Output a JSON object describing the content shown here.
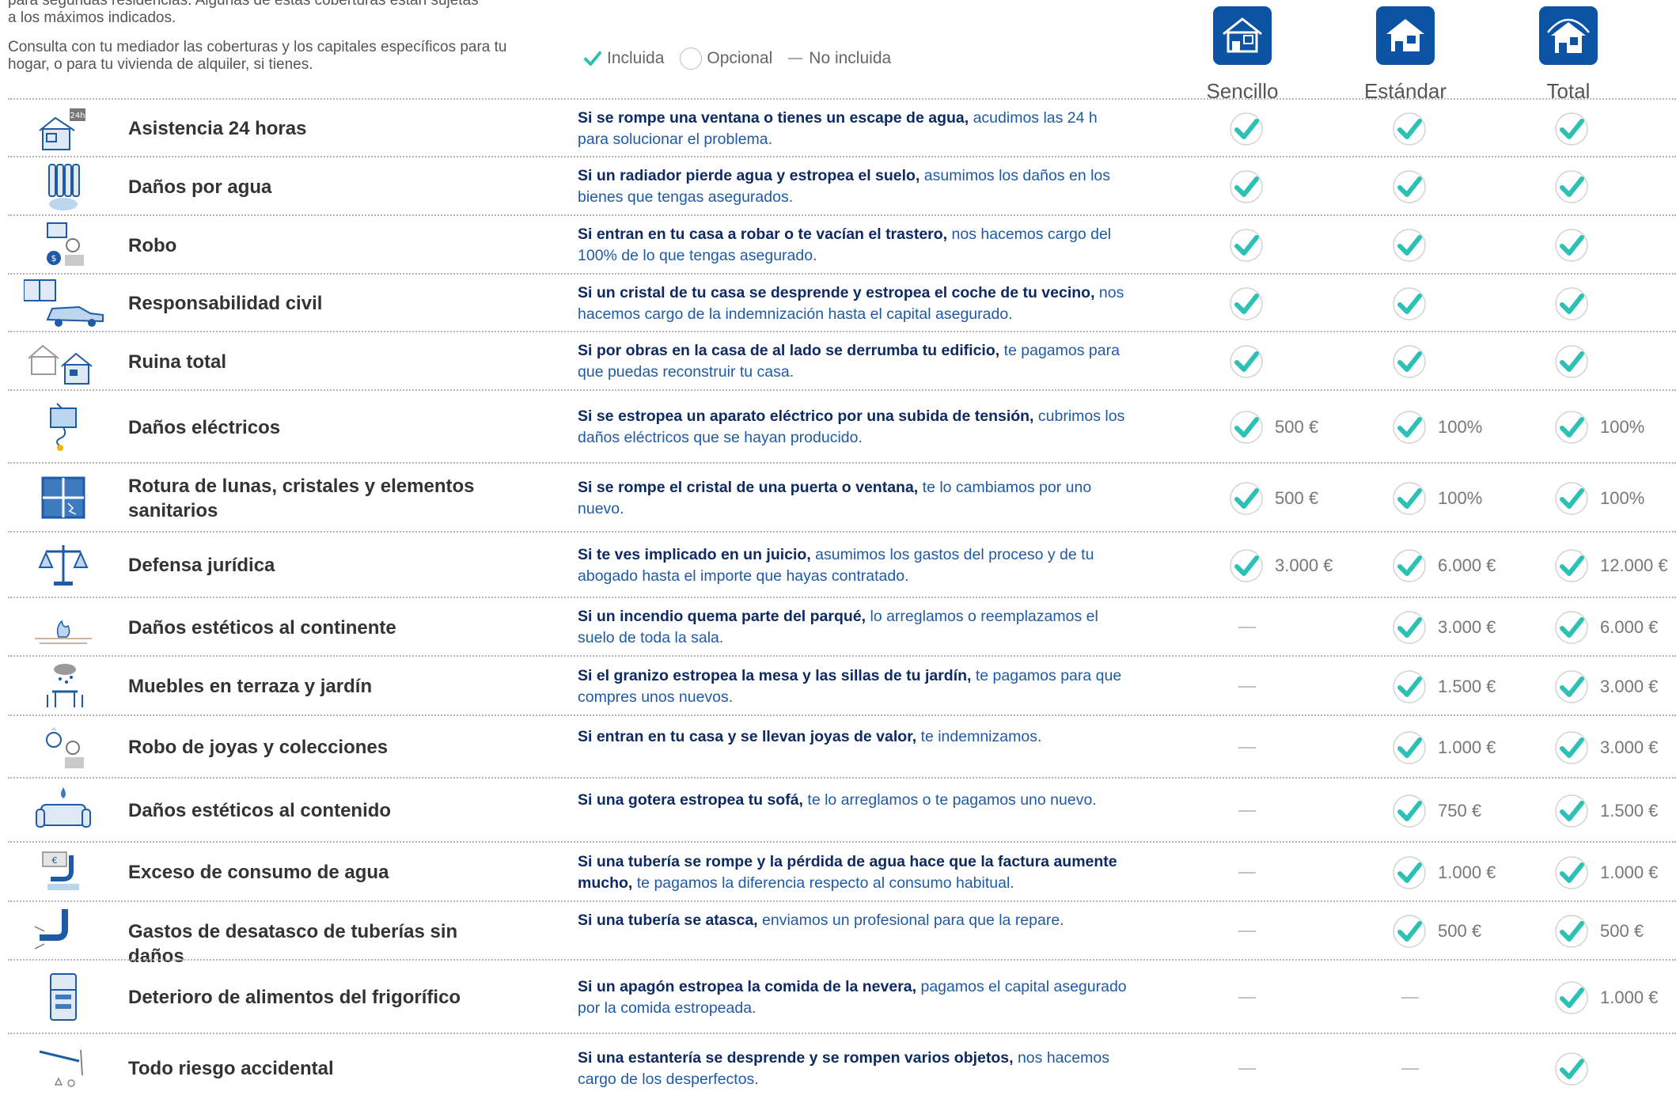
{
  "intro": {
    "line1": "para segundas residencias. Algunas de estas coberturas están sujetas a los máximos indicados.",
    "line2": "Consulta con tu mediador las coberturas y los capitales específicos para tu hogar, o para tu vivienda de alquiler, si tienes."
  },
  "legend": {
    "included": "Incluida",
    "optional": "Opcional",
    "not_included": "No incluida"
  },
  "plans": [
    "Sencillo",
    "Estándar",
    "Total"
  ],
  "colors": {
    "brand_blue": "#0c53a4",
    "check_teal": "#2cc1b4",
    "desc_blue": "#1f5aa6",
    "desc_bold": "#0e2a63"
  },
  "rows": [
    {
      "icon": "house-24h-icon",
      "title": "Asistencia 24 horas",
      "desc_bold": "Si se rompe una ventana o tienes un escape de agua,",
      "desc": " acudimos las 24 h para solucionar el problema.",
      "cells": [
        {
          "status": "included",
          "value": ""
        },
        {
          "status": "included",
          "value": ""
        },
        {
          "status": "included",
          "value": ""
        }
      ]
    },
    {
      "icon": "radiator-icon",
      "title": "Daños por agua",
      "desc_bold": "Si un radiador pierde agua y estropea el suelo,",
      "desc": " asumimos los daños en los bienes que tengas asegurados.",
      "cells": [
        {
          "status": "included",
          "value": ""
        },
        {
          "status": "included",
          "value": ""
        },
        {
          "status": "included",
          "value": ""
        }
      ]
    },
    {
      "icon": "robbery-icon",
      "title": "Robo",
      "desc_bold": "Si entran en tu casa a robar o te vacían el trastero,",
      "desc": " nos hacemos cargo del 100% de lo que tengas asegurado.",
      "cells": [
        {
          "status": "included",
          "value": ""
        },
        {
          "status": "included",
          "value": ""
        },
        {
          "status": "included",
          "value": ""
        }
      ]
    },
    {
      "icon": "window-car-icon",
      "title": "Responsabilidad civil",
      "desc_bold": "Si un cristal de tu casa se desprende y estropea el coche de tu vecino,",
      "desc": " nos hacemos cargo de la indemnización hasta el capital asegurado.",
      "cells": [
        {
          "status": "included",
          "value": ""
        },
        {
          "status": "included",
          "value": ""
        },
        {
          "status": "included",
          "value": ""
        }
      ]
    },
    {
      "icon": "collapsed-house-icon",
      "title": "Ruina total",
      "desc_bold": "Si por obras en la casa de al lado se derrumba tu edificio,",
      "desc": " te pagamos para que puedas reconstruir tu casa.",
      "cells": [
        {
          "status": "included",
          "value": ""
        },
        {
          "status": "included",
          "value": ""
        },
        {
          "status": "included",
          "value": ""
        }
      ]
    },
    {
      "icon": "tv-spark-icon",
      "title": "Daños eléctricos",
      "desc_bold": "Si se estropea un aparato eléctrico por una subida de tensión,",
      "desc": " cubrimos los daños eléctricos que se hayan producido.",
      "cells": [
        {
          "status": "included",
          "value": "500 €"
        },
        {
          "status": "included",
          "value": "100%"
        },
        {
          "status": "included",
          "value": "100%"
        }
      ]
    },
    {
      "icon": "broken-window-icon",
      "title": "Rotura de lunas, cristales y elementos sanitarios",
      "desc_bold": "Si se rompe el cristal de una puerta o ventana,",
      "desc": " te lo cambiamos por uno nuevo.",
      "cells": [
        {
          "status": "included",
          "value": "500 €"
        },
        {
          "status": "included",
          "value": "100%"
        },
        {
          "status": "included",
          "value": "100%"
        }
      ]
    },
    {
      "icon": "scales-icon",
      "title": "Defensa jurídica",
      "desc_bold": "Si te ves implicado en un juicio,",
      "desc": " asumimos los gastos del proceso y de tu abogado hasta el importe que hayas contratado.",
      "cells": [
        {
          "status": "included",
          "value": "3.000 €"
        },
        {
          "status": "included",
          "value": "6.000 €"
        },
        {
          "status": "included",
          "value": "12.000 €"
        }
      ]
    },
    {
      "icon": "burning-floor-icon",
      "title": "Daños estéticos al continente",
      "desc_bold": "Si un incendio quema parte del parqué,",
      "desc": " lo arreglamos o reemplazamos el suelo de toda la sala.",
      "cells": [
        {
          "status": "not_included",
          "value": ""
        },
        {
          "status": "included",
          "value": "3.000 €"
        },
        {
          "status": "included",
          "value": "6.000 €"
        }
      ]
    },
    {
      "icon": "hail-furniture-icon",
      "title": "Muebles en terraza y jardín",
      "desc_bold": "Si el granizo estropea la mesa y las sillas de tu jardín,",
      "desc": " te pagamos para que compres unos nuevos.",
      "cells": [
        {
          "status": "not_included",
          "value": ""
        },
        {
          "status": "included",
          "value": "1.500 €"
        },
        {
          "status": "included",
          "value": "3.000 €"
        }
      ]
    },
    {
      "icon": "jewel-thief-icon",
      "title": "Robo de joyas y colecciones",
      "desc_bold": "Si entran en tu casa y se llevan joyas de valor,",
      "desc": " te indemnizamos.",
      "cells": [
        {
          "status": "not_included",
          "value": ""
        },
        {
          "status": "included",
          "value": "1.000 €"
        },
        {
          "status": "included",
          "value": "3.000 €"
        }
      ]
    },
    {
      "icon": "leaking-sofa-icon",
      "title": "Daños estéticos al contenido",
      "desc_bold": "Si una gotera estropea tu sofá,",
      "desc": " te lo arreglamos o te pagamos uno nuevo.",
      "cells": [
        {
          "status": "not_included",
          "value": ""
        },
        {
          "status": "included",
          "value": "750 €"
        },
        {
          "status": "included",
          "value": "1.500 €"
        }
      ]
    },
    {
      "icon": "water-bill-icon",
      "title": "Exceso de consumo de agua",
      "desc_bold": "Si una tubería se rompe y la pérdida de agua hace que la factura aumente mucho,",
      "desc": " te pagamos la diferencia respecto al consumo habitual.",
      "cells": [
        {
          "status": "not_included",
          "value": ""
        },
        {
          "status": "included",
          "value": "1.000 €"
        },
        {
          "status": "included",
          "value": "1.000 €"
        }
      ]
    },
    {
      "icon": "clogged-pipe-icon",
      "title": "Gastos de desatasco de tuberías sin daños",
      "desc_bold": "Si una tubería se atasca,",
      "desc": " enviamos un profesional para que la repare.",
      "cells": [
        {
          "status": "not_included",
          "value": ""
        },
        {
          "status": "included",
          "value": "500 €"
        },
        {
          "status": "included",
          "value": "500 €"
        }
      ]
    },
    {
      "icon": "fridge-icon",
      "title": "Deterioro de alimentos del frigorífico",
      "desc_bold": "Si un apagón estropea la comida de la nevera,",
      "desc": " pagamos el capital asegurado por la comida estropeada.",
      "cells": [
        {
          "status": "not_included",
          "value": ""
        },
        {
          "status": "not_included",
          "value": ""
        },
        {
          "status": "included",
          "value": "1.000 €"
        }
      ]
    },
    {
      "icon": "falling-shelf-icon",
      "title": "Todo riesgo accidental",
      "desc_bold": "Si una estantería se desprende y se rompen varios objetos,",
      "desc": " nos hacemos cargo de los desperfectos.",
      "cells": [
        {
          "status": "not_included",
          "value": ""
        },
        {
          "status": "not_included",
          "value": ""
        },
        {
          "status": "included",
          "value": ""
        }
      ]
    }
  ]
}
